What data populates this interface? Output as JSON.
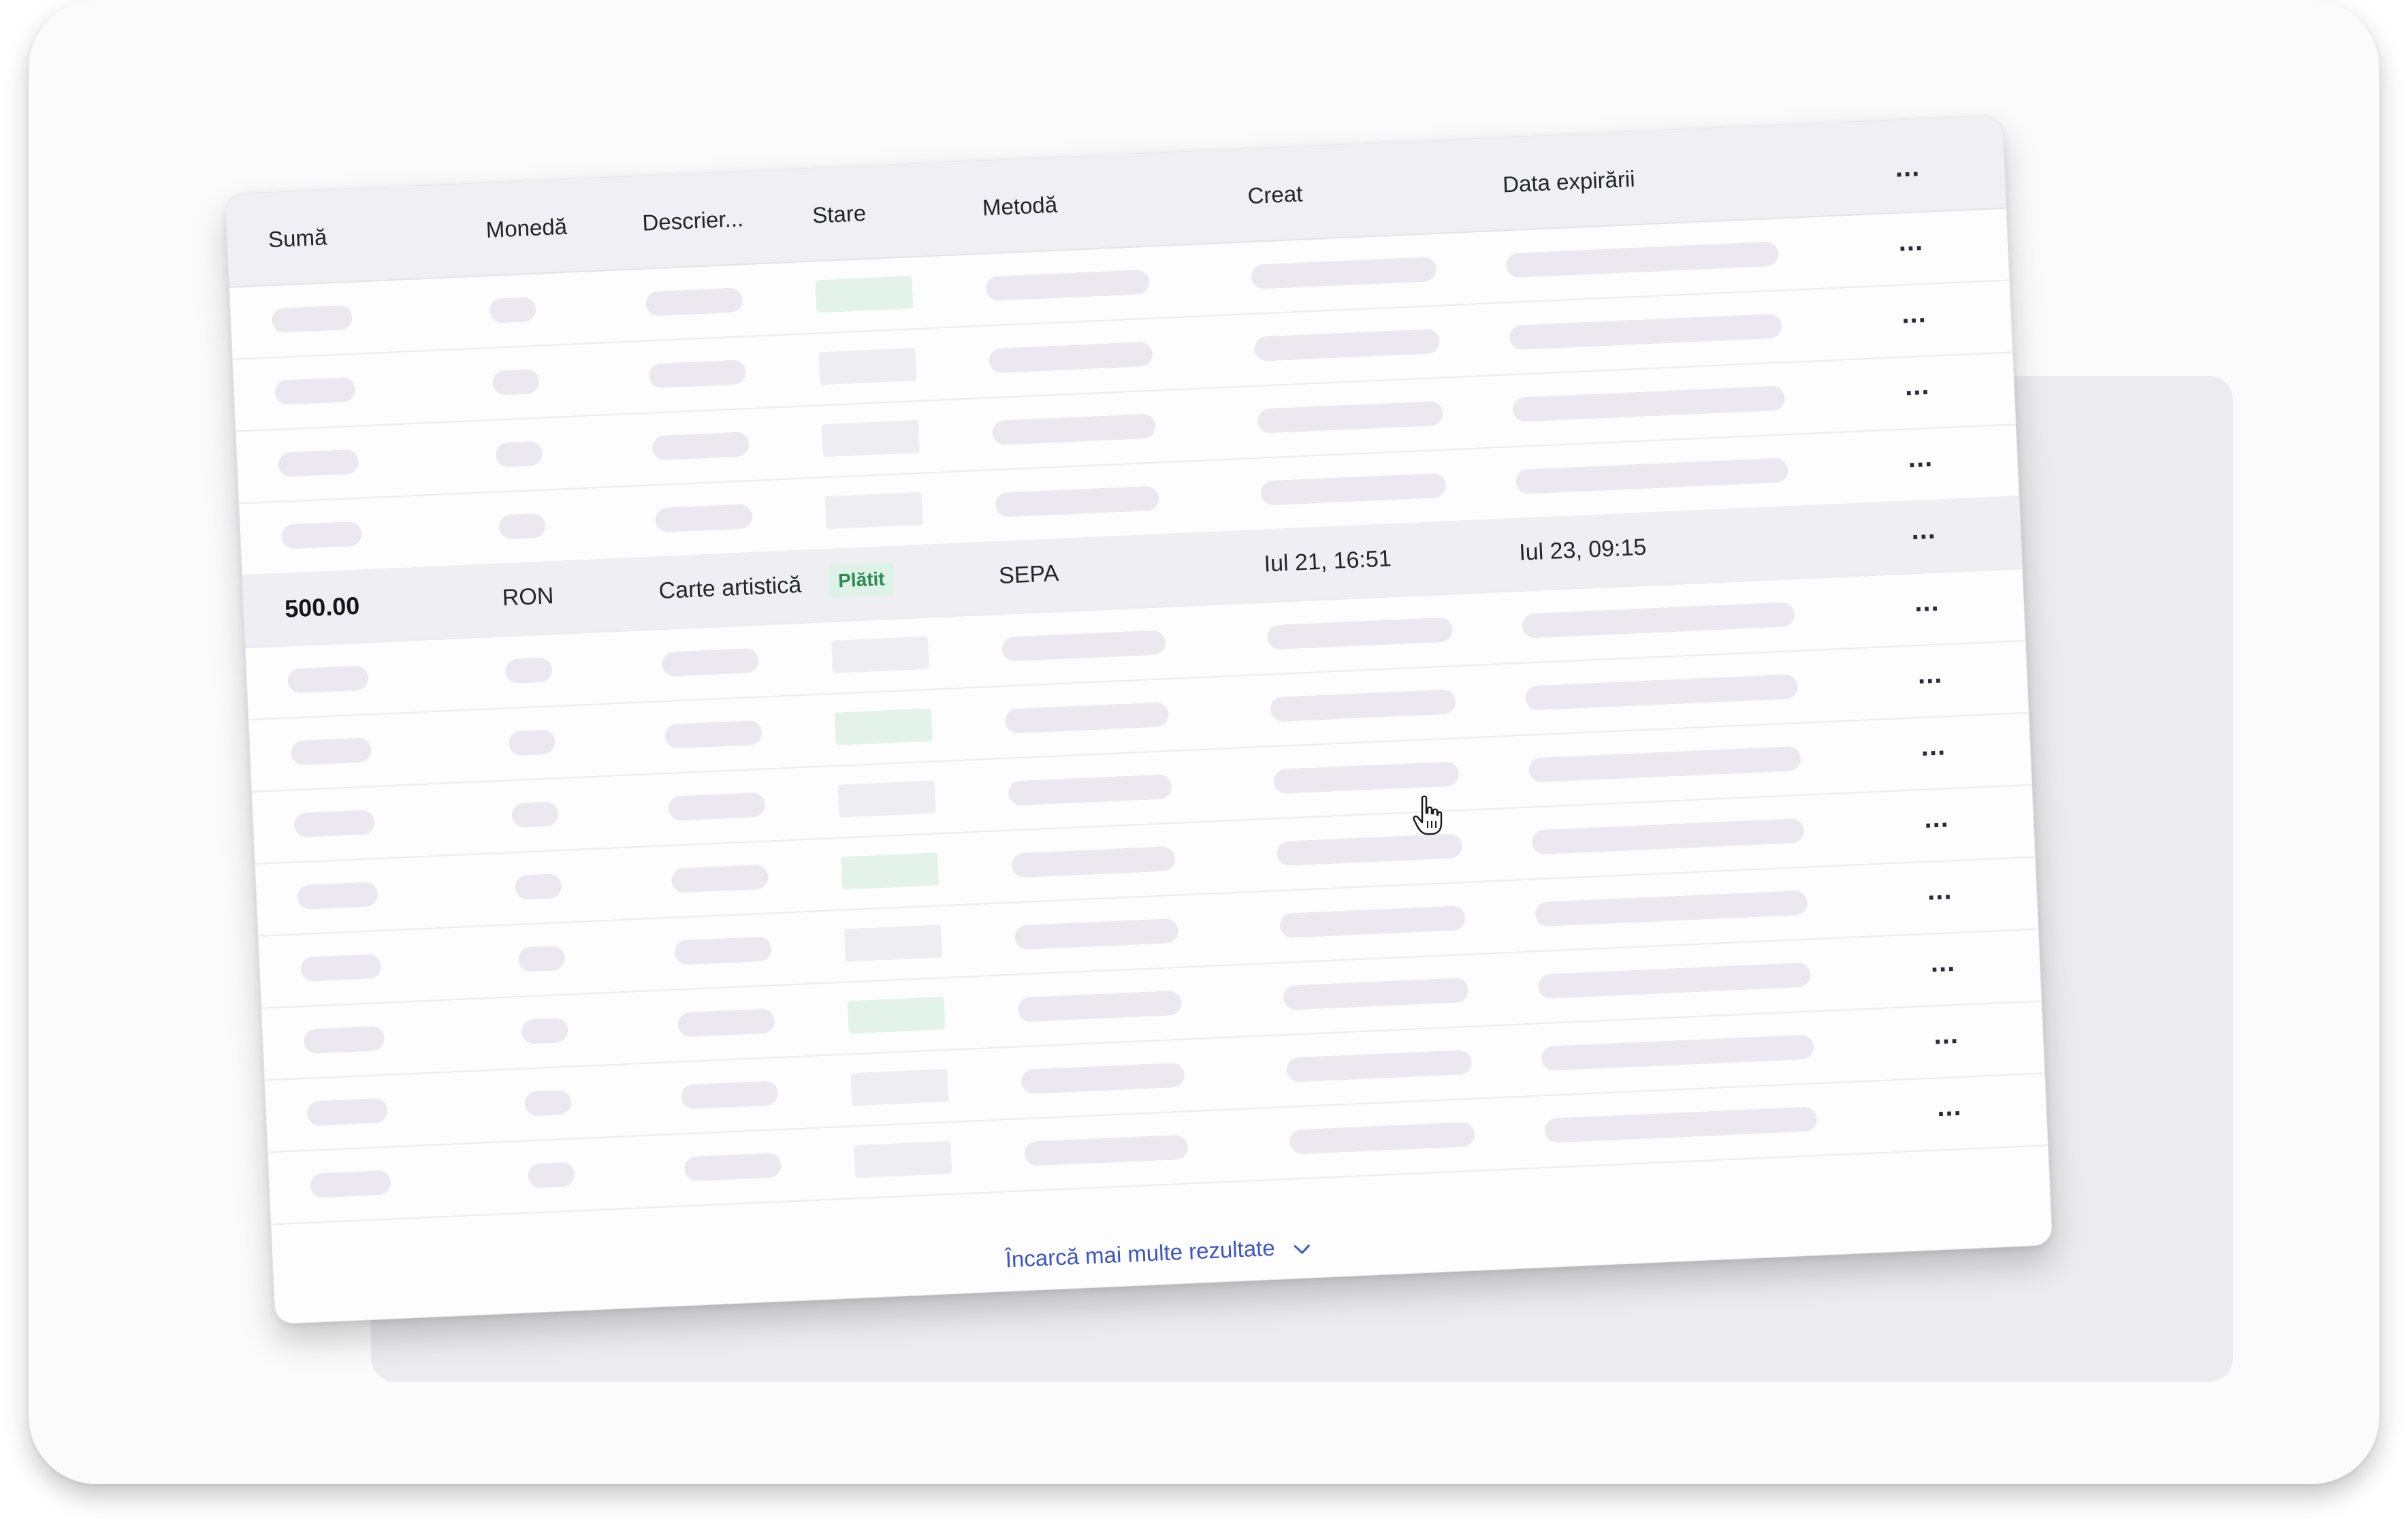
{
  "table": {
    "columns": [
      "Sumă",
      "Monedă",
      "Descrier...",
      "Stare",
      "Metodă",
      "Creat",
      "Data expirării"
    ],
    "highlighted_row": {
      "amount": "500.00",
      "currency": "RON",
      "description": "Carte artistică",
      "status": "Plătit",
      "method": "SEPA",
      "created": "Iul 21, 16:51",
      "expires": "Iul 23, 09:15"
    },
    "row_menu_label": "...",
    "placeholder_rows_above": 4,
    "placeholder_rows_below": 8,
    "load_more_label": "Încarcă mai multe rezultate"
  },
  "colors": {
    "accent_link": "#3c56c8",
    "status_paid_bg": "#dff2e7",
    "status_paid_text": "#2e8a55",
    "placeholder": "#ebe9ef"
  },
  "icons": {
    "row_menu": "more-horizontal-icon",
    "load_more": "chevron-down-icon",
    "cursor": "hand-pointer-icon"
  }
}
